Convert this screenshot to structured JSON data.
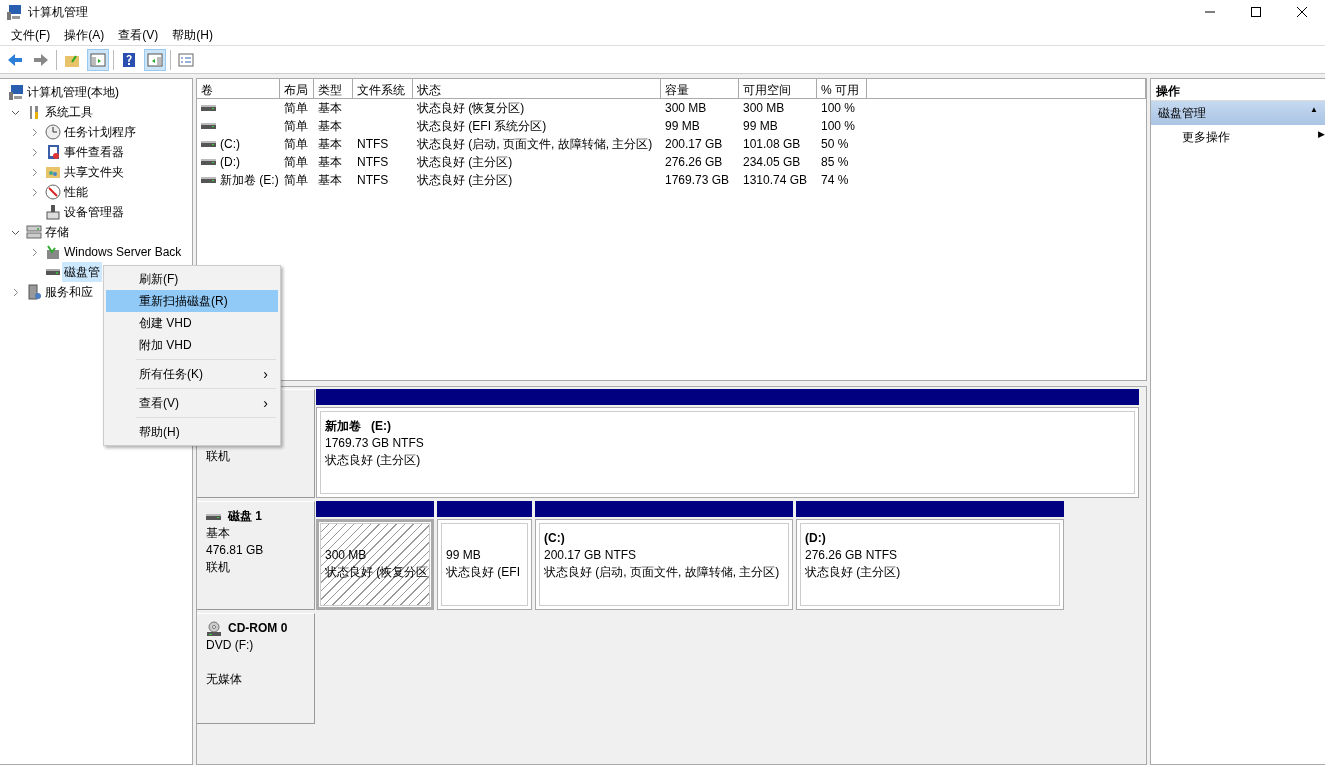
{
  "window": {
    "title": "计算机管理"
  },
  "menu_bar": [
    {
      "label": "文件(F)"
    },
    {
      "label": "操作(A)"
    },
    {
      "label": "查看(V)"
    },
    {
      "label": "帮助(H)"
    }
  ],
  "tree": [
    {
      "label": "计算机管理(本地)",
      "selected": false,
      "children": [
        {
          "label": "系统工具",
          "selected": false,
          "expanded": true,
          "children": [
            {
              "label": "任务计划程序",
              "selected": false,
              "expanded": false
            },
            {
              "label": "事件查看器",
              "selected": false,
              "expanded": false
            },
            {
              "label": "共享文件夹",
              "selected": false,
              "expanded": false
            },
            {
              "label": "性能",
              "selected": false,
              "expanded": false
            },
            {
              "label": "设备管理器",
              "selected": false
            }
          ]
        },
        {
          "label": "存储",
          "selected": false,
          "expanded": true,
          "children": [
            {
              "label": "Windows Server Back",
              "selected": false,
              "expanded": false
            },
            {
              "label": "磁盘管",
              "selected": true
            }
          ]
        },
        {
          "label": "服务和应",
          "selected": false,
          "expanded": false
        }
      ]
    }
  ],
  "volume_table": {
    "columns": [
      "卷",
      "布局",
      "类型",
      "文件系统",
      "状态",
      "容量",
      "可用空间",
      "% 可用"
    ],
    "rows": [
      {
        "cells": [
          "",
          "简单",
          "基本",
          "",
          "状态良好 (恢复分区)",
          "300 MB",
          "300 MB",
          "100 %"
        ]
      },
      {
        "cells": [
          "",
          "简单",
          "基本",
          "",
          "状态良好 (EFI 系统分区)",
          "99 MB",
          "99 MB",
          "100 %"
        ]
      },
      {
        "cells": [
          "(C:)",
          "简单",
          "基本",
          "NTFS",
          "状态良好 (启动, 页面文件, 故障转储, 主分区)",
          "200.17 GB",
          "101.08 GB",
          "50 %"
        ]
      },
      {
        "cells": [
          "(D:)",
          "简单",
          "基本",
          "NTFS",
          "状态良好 (主分区)",
          "276.26 GB",
          "234.05 GB",
          "85 %"
        ]
      },
      {
        "cells": [
          "新加卷 (E:)",
          "简单",
          "基本",
          "NTFS",
          "状态良好 (主分区)",
          "1769.73 GB",
          "1310.74 GB",
          "74 %"
        ]
      }
    ]
  },
  "disks": [
    {
      "kind": "disk",
      "lines": [
        "联机"
      ],
      "partitions": [
        {
          "title": "新加卷   (E:)",
          "size": "1769.73 GB NTFS",
          "status": "状态良好 (主分区)",
          "selected": false
        }
      ]
    },
    {
      "kind": "disk",
      "name": "磁盘 1",
      "lines": [
        "基本",
        "476.81 GB",
        "联机"
      ],
      "partitions": [
        {
          "size": "300 MB",
          "status": "状态良好 (恢复分区",
          "selected": true
        },
        {
          "size": "99 MB",
          "status": "状态良好 (EFI",
          "selected": false
        },
        {
          "title": "(C:)",
          "size": "200.17 GB NTFS",
          "status": "状态良好 (启动, 页面文件, 故障转储, 主分区)",
          "selected": false
        },
        {
          "title": "(D:)",
          "size": "276.26 GB NTFS",
          "status": "状态良好 (主分区)",
          "selected": false
        }
      ]
    },
    {
      "kind": "cdrom",
      "name": "CD-ROM 0",
      "lines": [
        "DVD (F:)",
        "无媒体"
      ]
    }
  ],
  "context_menu": [
    {
      "kind": "item",
      "label": "刷新(F)",
      "selected": false
    },
    {
      "kind": "item",
      "label": "重新扫描磁盘(R)",
      "selected": true
    },
    {
      "kind": "item",
      "label": "创建 VHD",
      "selected": false
    },
    {
      "kind": "item",
      "label": "附加 VHD",
      "selected": false
    },
    {
      "kind": "separator"
    },
    {
      "kind": "item",
      "label": "所有任务(K)",
      "selected": false,
      "arrow": "›"
    },
    {
      "kind": "separator"
    },
    {
      "kind": "item",
      "label": "查看(V)",
      "selected": false,
      "arrow": "›"
    },
    {
      "kind": "separator"
    },
    {
      "kind": "item",
      "label": "帮助(H)",
      "selected": false
    }
  ],
  "actions": {
    "title": "操作",
    "section": {
      "label": "磁盘管理",
      "arrow": "▲"
    },
    "items": [
      {
        "label": "更多操作",
        "arrow": "▶"
      }
    ]
  }
}
